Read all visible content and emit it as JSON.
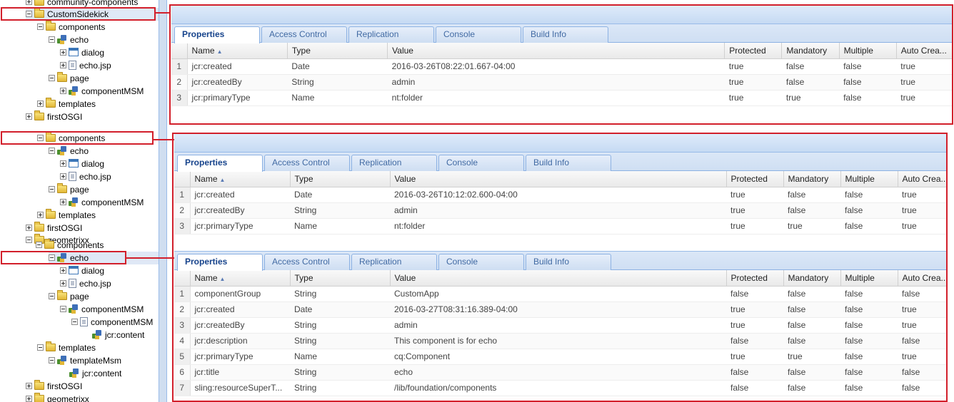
{
  "tree": {
    "nodes": [
      {
        "label": "community-components",
        "icon": "folder-icon",
        "state": "plus"
      },
      {
        "label": "CustomSidekick",
        "icon": "folder-icon",
        "state": "minus",
        "selected": true
      },
      {
        "label": "components",
        "icon": "folder-icon",
        "state": "minus"
      },
      {
        "label": "echo",
        "icon": "component-icon",
        "state": "minus"
      },
      {
        "label": "dialog",
        "icon": "dialog-icon",
        "state": "plus"
      },
      {
        "label": "echo.jsp",
        "icon": "file-icon",
        "state": "plus"
      },
      {
        "label": "page",
        "icon": "folder-icon",
        "state": "minus"
      },
      {
        "label": "componentMSM",
        "icon": "component-icon",
        "state": "plus"
      },
      {
        "label": "templates",
        "icon": "folder-icon",
        "state": "plus"
      },
      {
        "label": "firstOSGI",
        "icon": "folder-icon",
        "state": "plus"
      },
      {
        "label": "components",
        "icon": "folder-icon",
        "state": "minus"
      },
      {
        "label": "echo",
        "icon": "component-icon",
        "state": "minus"
      },
      {
        "label": "dialog",
        "icon": "dialog-icon",
        "state": "plus"
      },
      {
        "label": "echo.jsp",
        "icon": "file-icon",
        "state": "plus"
      },
      {
        "label": "page",
        "icon": "folder-icon",
        "state": "minus"
      },
      {
        "label": "componentMSM",
        "icon": "component-icon",
        "state": "plus"
      },
      {
        "label": "templates",
        "icon": "folder-icon",
        "state": "plus"
      },
      {
        "label": "firstOSGI",
        "icon": "folder-icon",
        "state": "plus"
      },
      {
        "label": "geometrixx",
        "icon": "folder-icon",
        "state": "minus"
      },
      {
        "label": "components",
        "icon": "folder-icon",
        "state": "minus"
      },
      {
        "label": "echo",
        "icon": "component-icon",
        "state": "minus",
        "selected": true
      },
      {
        "label": "dialog",
        "icon": "dialog-icon",
        "state": "plus"
      },
      {
        "label": "echo.jsp",
        "icon": "file-icon",
        "state": "plus"
      },
      {
        "label": "page",
        "icon": "folder-icon",
        "state": "minus"
      },
      {
        "label": "componentMSM",
        "icon": "component-icon",
        "state": "minus"
      },
      {
        "label": "componentMSM",
        "icon": "file-icon",
        "state": "minus"
      },
      {
        "label": "jcr:content",
        "icon": "component-icon",
        "state": "none"
      },
      {
        "label": "templates",
        "icon": "folder-icon",
        "state": "minus"
      },
      {
        "label": "templateMsm",
        "icon": "component-icon",
        "state": "minus"
      },
      {
        "label": "jcr:content",
        "icon": "component-icon",
        "state": "none"
      },
      {
        "label": "firstOSGI",
        "icon": "folder-icon",
        "state": "plus"
      },
      {
        "label": "geometrixx",
        "icon": "folder-icon",
        "state": "plus"
      }
    ]
  },
  "tabs": [
    "Properties",
    "Access Control",
    "Replication",
    "Console",
    "Build Info"
  ],
  "columns": [
    "Name",
    "Type",
    "Value",
    "Protected",
    "Mandatory",
    "Multiple",
    "Auto Crea..."
  ],
  "panels": [
    {
      "rows": [
        {
          "n": "1",
          "name": "jcr:created",
          "type": "Date",
          "value": "2016-03-26T08:22:01.667-04:00",
          "protected": "true",
          "mandatory": "false",
          "multiple": "false",
          "auto": "true"
        },
        {
          "n": "2",
          "name": "jcr:createdBy",
          "type": "String",
          "value": "admin",
          "protected": "true",
          "mandatory": "false",
          "multiple": "false",
          "auto": "true"
        },
        {
          "n": "3",
          "name": "jcr:primaryType",
          "type": "Name",
          "value": "nt:folder",
          "protected": "true",
          "mandatory": "true",
          "multiple": "false",
          "auto": "true"
        }
      ]
    },
    {
      "rows": [
        {
          "n": "1",
          "name": "jcr:created",
          "type": "Date",
          "value": "2016-03-26T10:12:02.600-04:00",
          "protected": "true",
          "mandatory": "false",
          "multiple": "false",
          "auto": "true"
        },
        {
          "n": "2",
          "name": "jcr:createdBy",
          "type": "String",
          "value": "admin",
          "protected": "true",
          "mandatory": "false",
          "multiple": "false",
          "auto": "true"
        },
        {
          "n": "3",
          "name": "jcr:primaryType",
          "type": "Name",
          "value": "nt:folder",
          "protected": "true",
          "mandatory": "true",
          "multiple": "false",
          "auto": "true"
        }
      ]
    },
    {
      "rows": [
        {
          "n": "1",
          "name": "componentGroup",
          "type": "String",
          "value": "CustomApp",
          "protected": "false",
          "mandatory": "false",
          "multiple": "false",
          "auto": "false"
        },
        {
          "n": "2",
          "name": "jcr:created",
          "type": "Date",
          "value": "2016-03-27T08:31:16.389-04:00",
          "protected": "true",
          "mandatory": "false",
          "multiple": "false",
          "auto": "true"
        },
        {
          "n": "3",
          "name": "jcr:createdBy",
          "type": "String",
          "value": "admin",
          "protected": "true",
          "mandatory": "false",
          "multiple": "false",
          "auto": "true"
        },
        {
          "n": "4",
          "name": "jcr:description",
          "type": "String",
          "value": "This component is for echo",
          "protected": "false",
          "mandatory": "false",
          "multiple": "false",
          "auto": "false"
        },
        {
          "n": "5",
          "name": "jcr:primaryType",
          "type": "Name",
          "value": "cq:Component",
          "protected": "true",
          "mandatory": "true",
          "multiple": "false",
          "auto": "true"
        },
        {
          "n": "6",
          "name": "jcr:title",
          "type": "String",
          "value": "echo",
          "protected": "false",
          "mandatory": "false",
          "multiple": "false",
          "auto": "false"
        },
        {
          "n": "7",
          "name": "sling:resourceSuperT...",
          "type": "String",
          "value": "/lib/foundation/components",
          "protected": "false",
          "mandatory": "false",
          "multiple": "false",
          "auto": "false"
        }
      ]
    }
  ]
}
